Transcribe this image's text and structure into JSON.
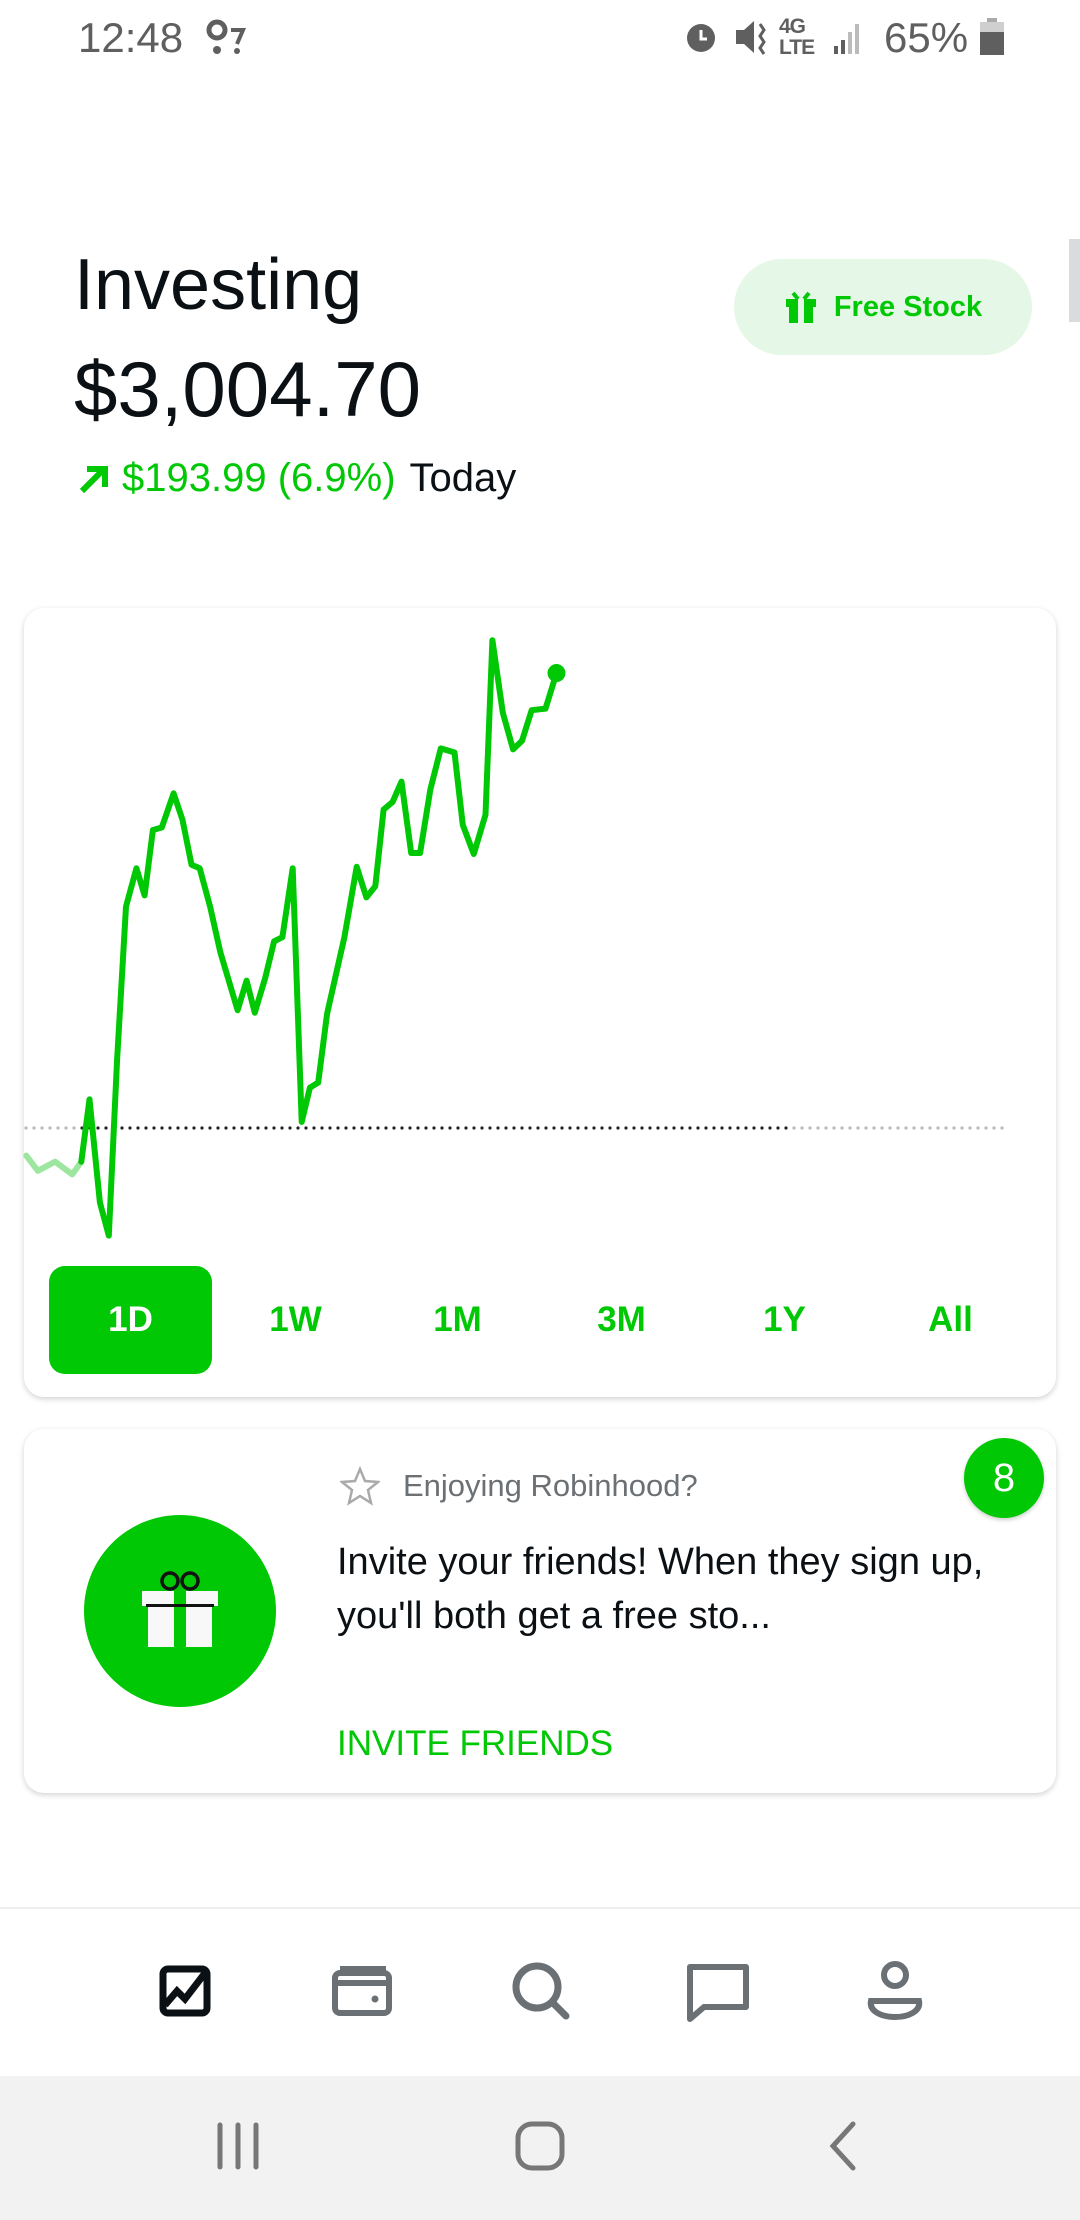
{
  "status_bar": {
    "time": "12:48",
    "battery": "65%",
    "network": "4G LTE"
  },
  "header": {
    "title": "Investing",
    "portfolio_value": "$3,004.70",
    "change_amount": "$193.99 (6.9%)",
    "change_period": "Today",
    "change_direction": "up",
    "free_stock_label": "Free Stock"
  },
  "colors": {
    "accent": "#00c805",
    "accent_light": "#e5f7e6",
    "faded_line": "#9de6a0",
    "text": "#0b1014",
    "icon_gray": "#6b7075"
  },
  "chart_data": {
    "type": "line",
    "title": "",
    "xlabel": "",
    "ylabel": "",
    "grid": false,
    "baseline": 2810.71,
    "premarket_values": [
      2798.96,
      2792.44,
      2796.35,
      2790.91,
      2796.35
    ],
    "values": [
      2796.35,
      2822.89,
      2778.95,
      2764.81,
      2839.86,
      2905.13,
      2921.44,
      2909.91,
      2937.76,
      2938.85,
      2953.42,
      2942.11,
      2922.97,
      2921.44,
      2905.13,
      2885.55,
      2860.96,
      2873.58,
      2859.88,
      2874.67,
      2890.33,
      2892.07,
      2921.44,
      2813.32,
      2827.9,
      2830.07,
      2859.44,
      2892.07,
      2922.1,
      2909.04,
      2913.83,
      2946.46,
      2949.73,
      2958.43,
      2927.97,
      2927.97,
      2955.16,
      2972.57,
      2970.83,
      2939.93,
      2927.53,
      2944.29,
      3018.69,
      2987.8,
      2972.13,
      2975.83,
      2988.88,
      2989.54,
      3004.7
    ]
  },
  "ranges": [
    {
      "label": "1D",
      "selected": true
    },
    {
      "label": "1W",
      "selected": false
    },
    {
      "label": "1M",
      "selected": false
    },
    {
      "label": "3M",
      "selected": false
    },
    {
      "label": "1Y",
      "selected": false
    },
    {
      "label": "All",
      "selected": false
    }
  ],
  "promo": {
    "badge_count": "8",
    "eyebrow": "Enjoying Robinhood?",
    "body": "Invite your friends! When they sign up, you'll both get a free sto...",
    "cta": "INVITE FRIENDS"
  },
  "bottom_nav": [
    {
      "icon": "chart-icon",
      "active": true
    },
    {
      "icon": "wallet-icon",
      "active": false
    },
    {
      "icon": "search-icon",
      "active": false
    },
    {
      "icon": "message-icon",
      "active": false
    },
    {
      "icon": "account-icon",
      "active": false
    }
  ]
}
